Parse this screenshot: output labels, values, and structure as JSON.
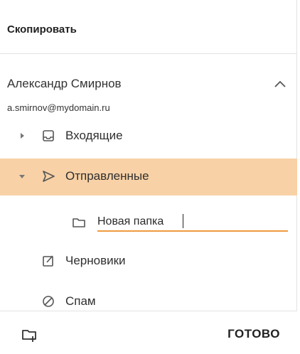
{
  "header": {
    "title": "Скопировать"
  },
  "account": {
    "name": "Александр Смирнов",
    "email": "a.smirnov@mydomain.ru",
    "collapse_icon": "chevron-up-icon"
  },
  "folders": [
    {
      "label": "Входящие",
      "icon": "inbox-icon",
      "expander": "caret-right-icon",
      "selected": false
    },
    {
      "label": "Отправленные",
      "icon": "send-icon",
      "expander": "caret-down-icon",
      "selected": true
    },
    {
      "label": "Черновики",
      "icon": "edit-icon",
      "selected": false
    },
    {
      "label": "Спам",
      "icon": "block-icon",
      "selected": false
    }
  ],
  "new_folder": {
    "value": "Новая папка",
    "icon": "folder-icon"
  },
  "footer": {
    "new_folder_icon": "folder-add-icon",
    "done_label": "ГОТОВО"
  },
  "colors": {
    "selected_bg": "#f8d1a6",
    "accent": "#f09a3e",
    "text": "#2f2f2f",
    "icon": "#555555"
  }
}
